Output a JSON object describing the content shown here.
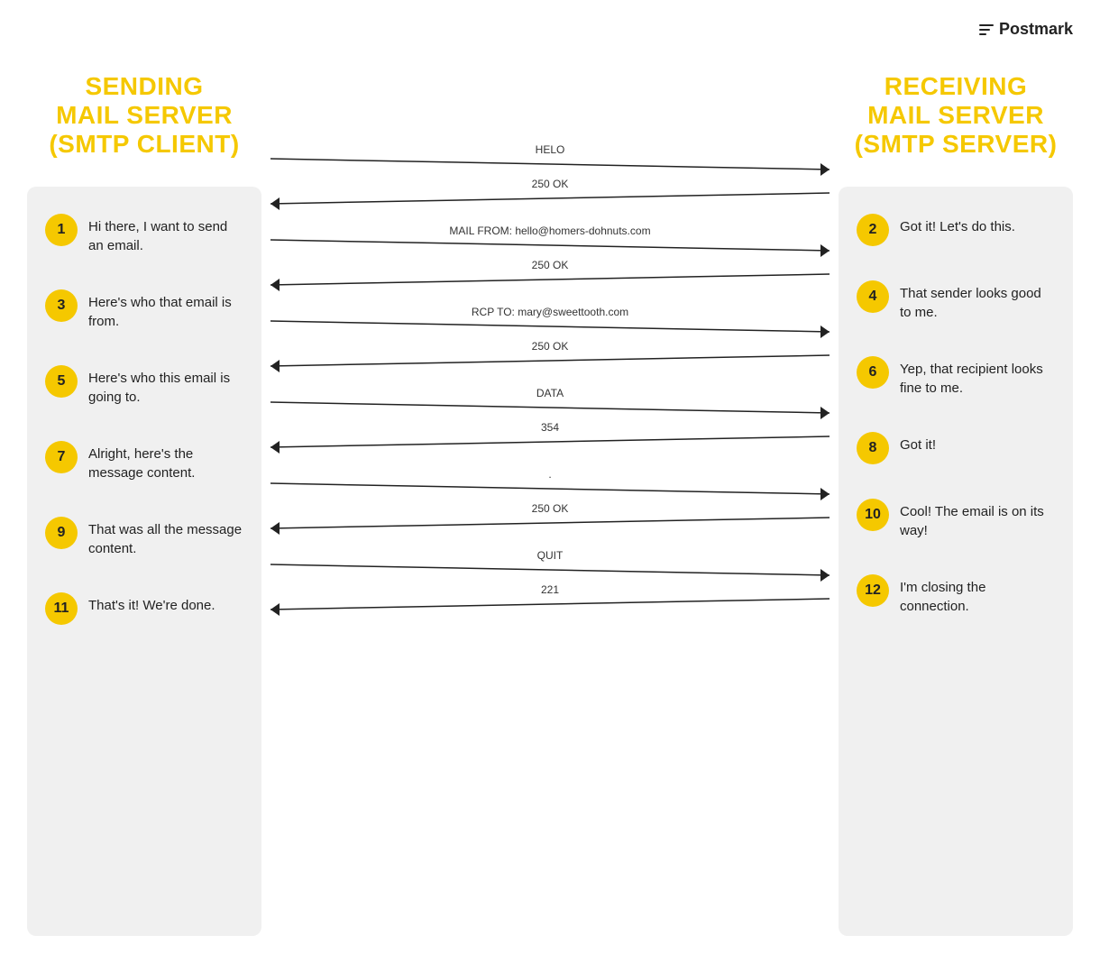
{
  "logo": {
    "text": "Postmark"
  },
  "left": {
    "title": "SENDING\nMAIL SERVER\n(SMTP CLIENT)",
    "steps": [
      {
        "number": "1",
        "text": "Hi there, I want to send an email."
      },
      {
        "number": "3",
        "text": "Here's who that email is from."
      },
      {
        "number": "5",
        "text": "Here's who this email is going to."
      },
      {
        "number": "7",
        "text": "Alright, here's the message content."
      },
      {
        "number": "9",
        "text": "That was all the message content."
      },
      {
        "number": "11",
        "text": "That's it! We're done."
      }
    ]
  },
  "right": {
    "title": "RECEIVING\nMAIL SERVER\n(SMTP SERVER)",
    "steps": [
      {
        "number": "2",
        "text": "Got it! Let's do this."
      },
      {
        "number": "4",
        "text": "That sender looks good to me."
      },
      {
        "number": "6",
        "text": "Yep, that recipient looks fine to me."
      },
      {
        "number": "8",
        "text": "Got it!"
      },
      {
        "number": "10",
        "text": "Cool! The email is on its way!"
      },
      {
        "number": "12",
        "text": "I'm closing the connection."
      }
    ]
  },
  "arrows": [
    {
      "direction": "right",
      "label": "HELO",
      "labelPos": "top"
    },
    {
      "direction": "left",
      "label": "250 OK",
      "labelPos": "top"
    },
    {
      "direction": "right",
      "label": "MAIL FROM: hello@homers-dohnuts.com",
      "labelPos": "top"
    },
    {
      "direction": "left",
      "label": "250 OK",
      "labelPos": "top"
    },
    {
      "direction": "right",
      "label": "RCP TO: mary@sweettooth.com",
      "labelPos": "top"
    },
    {
      "direction": "left",
      "label": "250 OK",
      "labelPos": "top"
    },
    {
      "direction": "right",
      "label": "DATA",
      "labelPos": "top"
    },
    {
      "direction": "left",
      "label": "354",
      "labelPos": "top"
    },
    {
      "direction": "right",
      "label": ".",
      "labelPos": "top"
    },
    {
      "direction": "left",
      "label": "250 OK",
      "labelPos": "top"
    },
    {
      "direction": "right",
      "label": "QUIT",
      "labelPos": "top"
    },
    {
      "direction": "left",
      "label": "221",
      "labelPos": "top"
    }
  ],
  "colors": {
    "yellow": "#f5c800",
    "bg_panel": "#f0f0f0",
    "text": "#222222"
  }
}
